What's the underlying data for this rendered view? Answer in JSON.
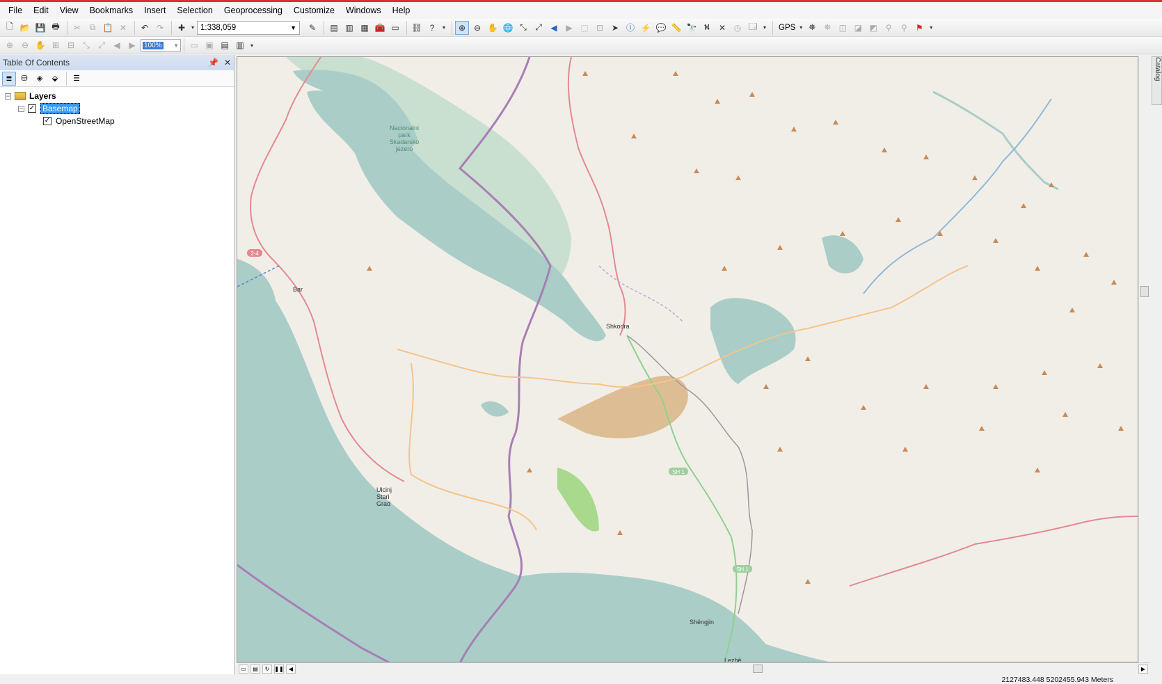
{
  "menu": [
    "File",
    "Edit",
    "View",
    "Bookmarks",
    "Insert",
    "Selection",
    "Geoprocessing",
    "Customize",
    "Windows",
    "Help"
  ],
  "toolbar": {
    "scale_value": "1:338,059",
    "gps_label": "GPS",
    "percent_value": "100%"
  },
  "toc": {
    "title": "Table Of Contents",
    "layers_label": "Layers",
    "basemap_label": "Basemap",
    "osm_label": "OpenStreetMap"
  },
  "map": {
    "labels": {
      "park": [
        "Nacionalni",
        "park",
        "Skadarsko",
        "jezero"
      ],
      "bar": "Bar",
      "shkodra": "Shkodra",
      "ulcinj": [
        "Ulcinj",
        "Stari",
        "Grad"
      ],
      "shengjin": "Shëngjin",
      "lezhe": "Lezhë",
      "sh1_a": "SH 1",
      "sh1_b": "SH 1",
      "road_24": "2-4"
    }
  },
  "catalog_tab": "Catalog",
  "status": {
    "coordinates": "2127483.448  5202455.943 Meters"
  },
  "colors": {
    "water": "#aacdc8",
    "land": "#f1eee8",
    "park_green": "#c9dfcf",
    "border_purple": "#a77fb4",
    "primary_road": "#e48a8f",
    "secondary_road": "#f5c48c",
    "peak_marker": "#c98a55",
    "selection_blue": "#3399ff"
  }
}
